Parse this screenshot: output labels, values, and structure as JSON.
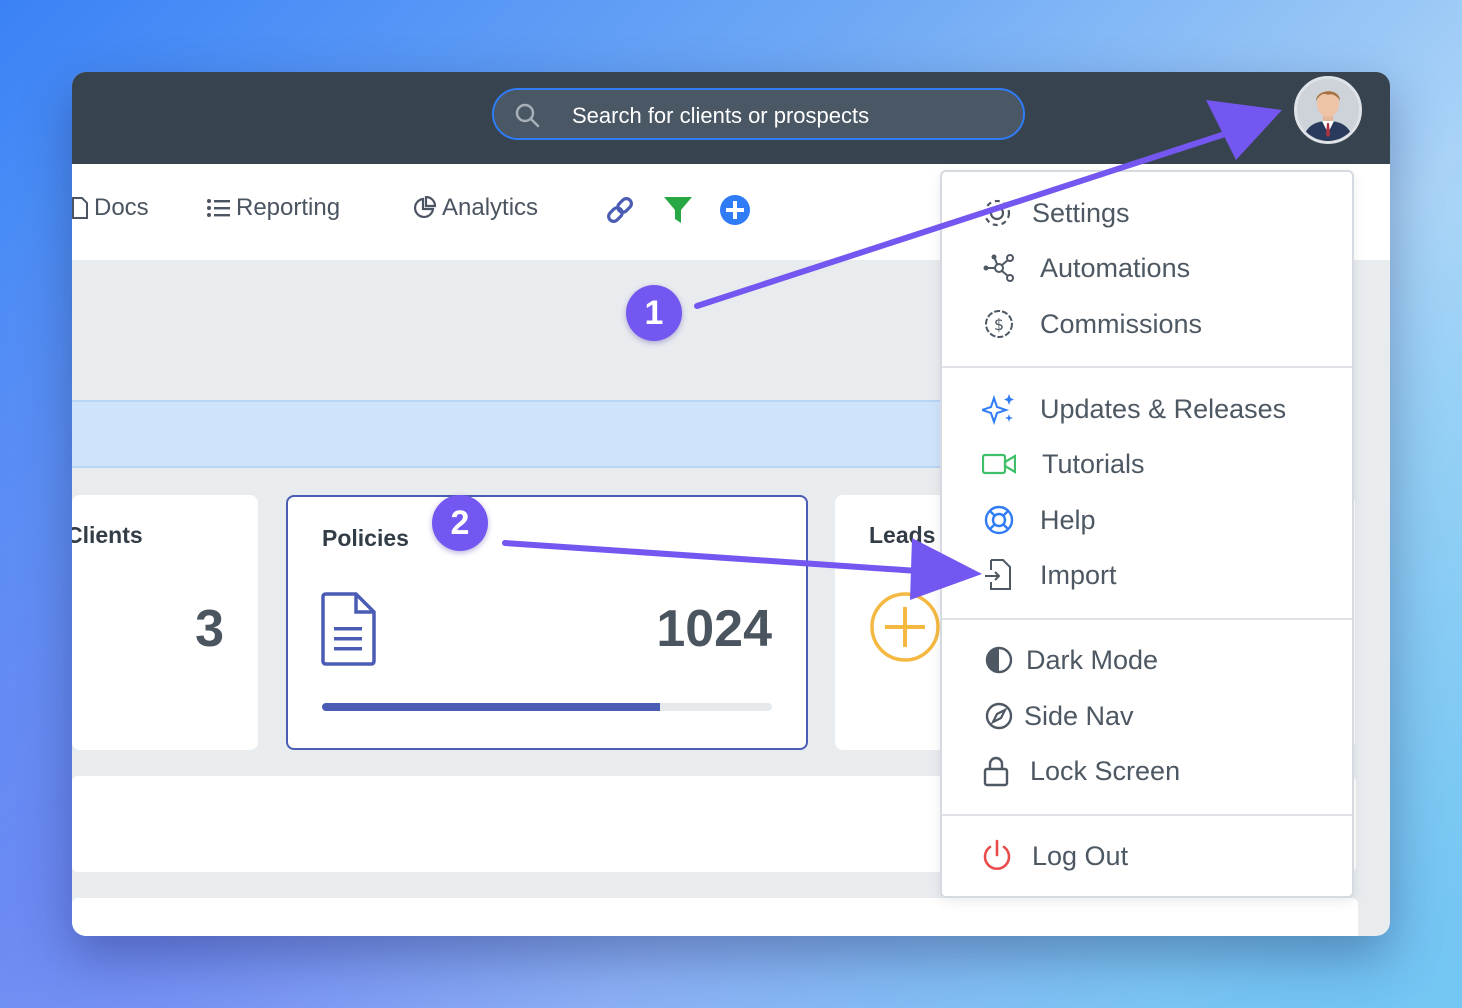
{
  "search": {
    "placeholder": "Search for clients or prospects"
  },
  "nav": {
    "docs": "Docs",
    "reporting": "Reporting",
    "analytics": "Analytics"
  },
  "cards": {
    "clients": {
      "title": "Clients",
      "value": "3"
    },
    "policies": {
      "title": "Policies",
      "value": "1024",
      "progress": 0.75
    },
    "leads": {
      "title": "Leads"
    }
  },
  "menu": {
    "settings": "Settings",
    "automations": "Automations",
    "commissions": "Commissions",
    "updates": "Updates & Releases",
    "tutorials": "Tutorials",
    "help": "Help",
    "import": "Import",
    "dark_mode": "Dark Mode",
    "side_nav": "Side Nav",
    "lock_screen": "Lock Screen",
    "log_out": "Log Out"
  },
  "annotations": {
    "step1": "1",
    "step2": "2"
  },
  "colors": {
    "topbar": "#37434f",
    "accent_blue": "#2f7cf6",
    "annotation_purple": "#7457f0",
    "policy_blue": "#4a5cb4",
    "leads_orange": "#f5b942",
    "logout_red": "#e94b4b",
    "tutorial_green": "#3fbf6a",
    "filter_green": "#27a844"
  }
}
